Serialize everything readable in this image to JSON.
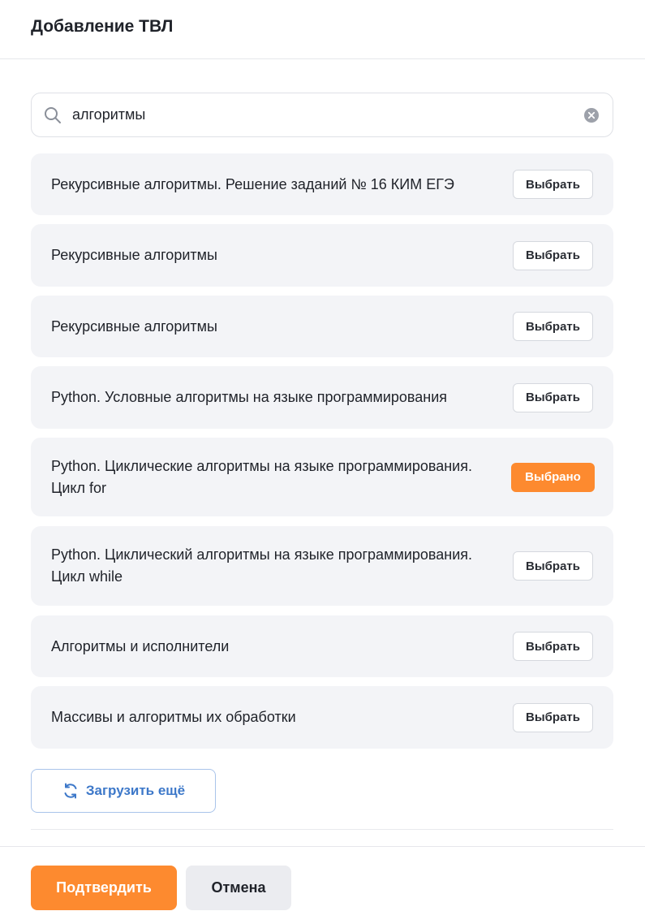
{
  "modal": {
    "title": "Добавление ТВЛ"
  },
  "search": {
    "value": "алгоритмы",
    "placeholder": ""
  },
  "results": [
    {
      "title": "Рекурсивные алгоритмы. Решение заданий № 16 КИМ ЕГЭ",
      "button": "Выбрать",
      "selected": false
    },
    {
      "title": "Рекурсивные алгоритмы",
      "button": "Выбрать",
      "selected": false
    },
    {
      "title": "Рекурсивные алгоритмы",
      "button": "Выбрать",
      "selected": false
    },
    {
      "title": "Python. Условные алгоритмы на языке программирования",
      "button": "Выбрать",
      "selected": false
    },
    {
      "title": "Python. Циклические алгоритмы на языке программирования. Цикл for",
      "button": "Выбрано",
      "selected": true
    },
    {
      "title": "Python. Циклический алгоритмы на языке программирования. Цикл while",
      "button": "Выбрать",
      "selected": false
    },
    {
      "title": "Алгоритмы и исполнители",
      "button": "Выбрать",
      "selected": false
    },
    {
      "title": "Массивы и алгоритмы их обработки",
      "button": "Выбрать",
      "selected": false
    }
  ],
  "load_more": {
    "label": "Загрузить ещё"
  },
  "footer": {
    "confirm_label": "Подтвердить",
    "cancel_label": "Отмена"
  },
  "colors": {
    "accent": "#fd8a2f",
    "link": "#3d78c9",
    "item_bg": "#f3f4f7"
  },
  "icons": {
    "search": "search-icon",
    "clear": "clear-icon",
    "refresh": "refresh-icon"
  }
}
